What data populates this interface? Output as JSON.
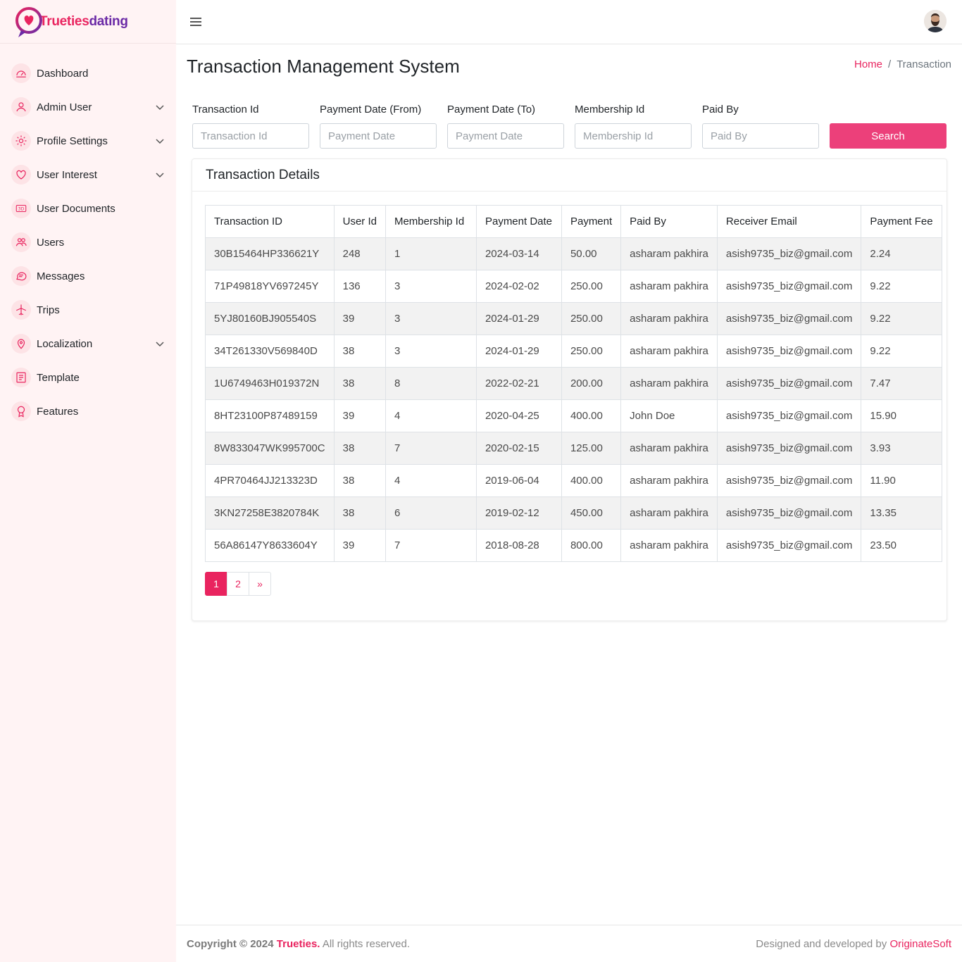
{
  "brand": {
    "part1": "Trueties",
    "part2": "dating"
  },
  "sidebar": {
    "items": [
      {
        "label": "Dashboard",
        "icon": "dashboard-icon",
        "has_submenu": false
      },
      {
        "label": "Admin User",
        "icon": "user-icon",
        "has_submenu": true
      },
      {
        "label": "Profile Settings",
        "icon": "gear-icon",
        "has_submenu": true
      },
      {
        "label": "User Interest",
        "icon": "heart-icon",
        "has_submenu": true
      },
      {
        "label": "User Documents",
        "icon": "3d-icon",
        "has_submenu": false
      },
      {
        "label": "Users",
        "icon": "users-icon",
        "has_submenu": false
      },
      {
        "label": "Messages",
        "icon": "chat-icon",
        "has_submenu": false
      },
      {
        "label": "Trips",
        "icon": "plane-icon",
        "has_submenu": false
      },
      {
        "label": "Localization",
        "icon": "location-pin-icon",
        "has_submenu": true
      },
      {
        "label": "Template",
        "icon": "template-icon",
        "has_submenu": false
      },
      {
        "label": "Features",
        "icon": "award-icon",
        "has_submenu": false
      }
    ]
  },
  "page": {
    "title": "Transaction Management System",
    "breadcrumb": {
      "home": "Home",
      "separator": "/",
      "current": "Transaction"
    }
  },
  "filters": {
    "transaction_id": {
      "label": "Transaction Id",
      "placeholder": "Transaction Id",
      "value": ""
    },
    "payment_date_from": {
      "label": "Payment Date (From)",
      "placeholder": "Payment Date",
      "value": ""
    },
    "payment_date_to": {
      "label": "Payment Date (To)",
      "placeholder": "Payment Date",
      "value": ""
    },
    "membership_id": {
      "label": "Membership Id",
      "placeholder": "Membership Id",
      "value": ""
    },
    "paid_by": {
      "label": "Paid By",
      "placeholder": "Paid By",
      "value": ""
    },
    "search_label": "Search"
  },
  "card": {
    "title": "Transaction Details"
  },
  "table": {
    "columns": [
      "Transaction ID",
      "User Id",
      "Membership Id",
      "Payment Date",
      "Payment",
      "Paid By",
      "Receiver Email",
      "Payment Fee"
    ],
    "rows": [
      [
        "30B15464HP336621Y",
        "248",
        "1",
        "2024-03-14",
        "50.00",
        "asharam pakhira",
        "asish9735_biz@gmail.com",
        "2.24"
      ],
      [
        "71P49818YV697245Y",
        "136",
        "3",
        "2024-02-02",
        "250.00",
        "asharam pakhira",
        "asish9735_biz@gmail.com",
        "9.22"
      ],
      [
        "5YJ80160BJ905540S",
        "39",
        "3",
        "2024-01-29",
        "250.00",
        "asharam pakhira",
        "asish9735_biz@gmail.com",
        "9.22"
      ],
      [
        "34T261330V569840D",
        "38",
        "3",
        "2024-01-29",
        "250.00",
        "asharam pakhira",
        "asish9735_biz@gmail.com",
        "9.22"
      ],
      [
        "1U6749463H019372N",
        "38",
        "8",
        "2022-02-21",
        "200.00",
        "asharam pakhira",
        "asish9735_biz@gmail.com",
        "7.47"
      ],
      [
        "8HT23100P87489159",
        "39",
        "4",
        "2020-04-25",
        "400.00",
        "John Doe",
        "asish9735_biz@gmail.com",
        "15.90"
      ],
      [
        "8W833047WK995700C",
        "38",
        "7",
        "2020-02-15",
        "125.00",
        "asharam pakhira",
        "asish9735_biz@gmail.com",
        "3.93"
      ],
      [
        "4PR70464JJ213323D",
        "38",
        "4",
        "2019-06-04",
        "400.00",
        "asharam pakhira",
        "asish9735_biz@gmail.com",
        "11.90"
      ],
      [
        "3KN27258E3820784K",
        "38",
        "6",
        "2019-02-12",
        "450.00",
        "asharam pakhira",
        "asish9735_biz@gmail.com",
        "13.35"
      ],
      [
        "56A86147Y8633604Y",
        "39",
        "7",
        "2018-08-28",
        "800.00",
        "asharam pakhira",
        "asish9735_biz@gmail.com",
        "23.50"
      ]
    ]
  },
  "pagination": {
    "pages": [
      "1",
      "2"
    ],
    "next": "»",
    "current": "1"
  },
  "footer": {
    "copyright_prefix": "Copyright © 2024",
    "brand": "Trueties.",
    "rights": "All rights reserved.",
    "designed_by": "Designed and developed by",
    "developer": "OriginateSoft"
  },
  "colors": {
    "accent": "#e9245f",
    "button": "#ec407a",
    "sidebar_bg": "#fff3f4"
  }
}
